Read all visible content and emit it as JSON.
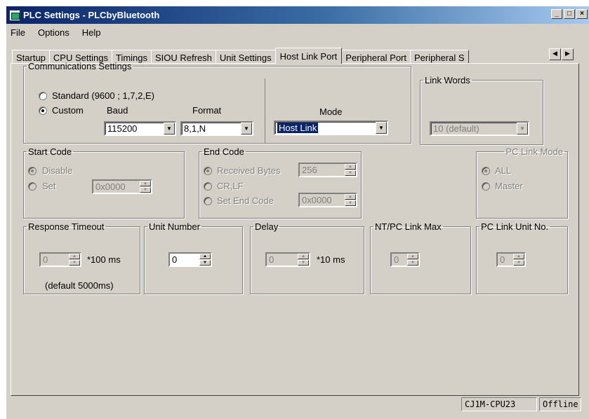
{
  "window": {
    "title": "PLC Settings - PLCbyBluetooth",
    "min": "_",
    "max": "□",
    "close": "×"
  },
  "menu": {
    "file": "File",
    "options": "Options",
    "help": "Help"
  },
  "tabs": [
    "Startup",
    "CPU Settings",
    "Timings",
    "SIOU Refresh",
    "Unit Settings",
    "Host Link Port",
    "Peripheral Port",
    "Peripheral S"
  ],
  "active_tab": "Host Link Port",
  "comm": {
    "legend": "Communications Settings",
    "standard": "Standard (9600 ; 1,7,2,E)",
    "custom": "Custom",
    "baud_label": "Baud",
    "baud_value": "115200",
    "format_label": "Format",
    "format_value": "8,1,N",
    "mode_label": "Mode",
    "mode_value": "Host Link"
  },
  "link_words": {
    "legend": "Link Words",
    "value": "10 (default)"
  },
  "start_code": {
    "legend": "Start Code",
    "disable": "Disable",
    "set": "Set",
    "value": "0x0000"
  },
  "end_code": {
    "legend": "End Code",
    "received": "Received Bytes",
    "received_value": "256",
    "crlf": "CR,LF",
    "set_end": "Set End Code",
    "set_end_value": "0x0000"
  },
  "pc_link_mode": {
    "legend": "PC Link Mode",
    "all": "ALL",
    "master": "Master"
  },
  "response_timeout": {
    "legend": "Response Timeout",
    "value": "0",
    "unit": "*100 ms",
    "note": "(default 5000ms)"
  },
  "unit_number": {
    "legend": "Unit Number",
    "value": "0"
  },
  "delay": {
    "legend": "Delay",
    "value": "0",
    "unit": "*10 ms"
  },
  "nt_pc_link_max": {
    "legend": "NT/PC Link Max",
    "value": "0"
  },
  "pc_link_unit_no": {
    "legend": "PC Link Unit No.",
    "value": "0"
  },
  "status": {
    "model": "CJ1M-CPU23",
    "state": "Offline"
  }
}
